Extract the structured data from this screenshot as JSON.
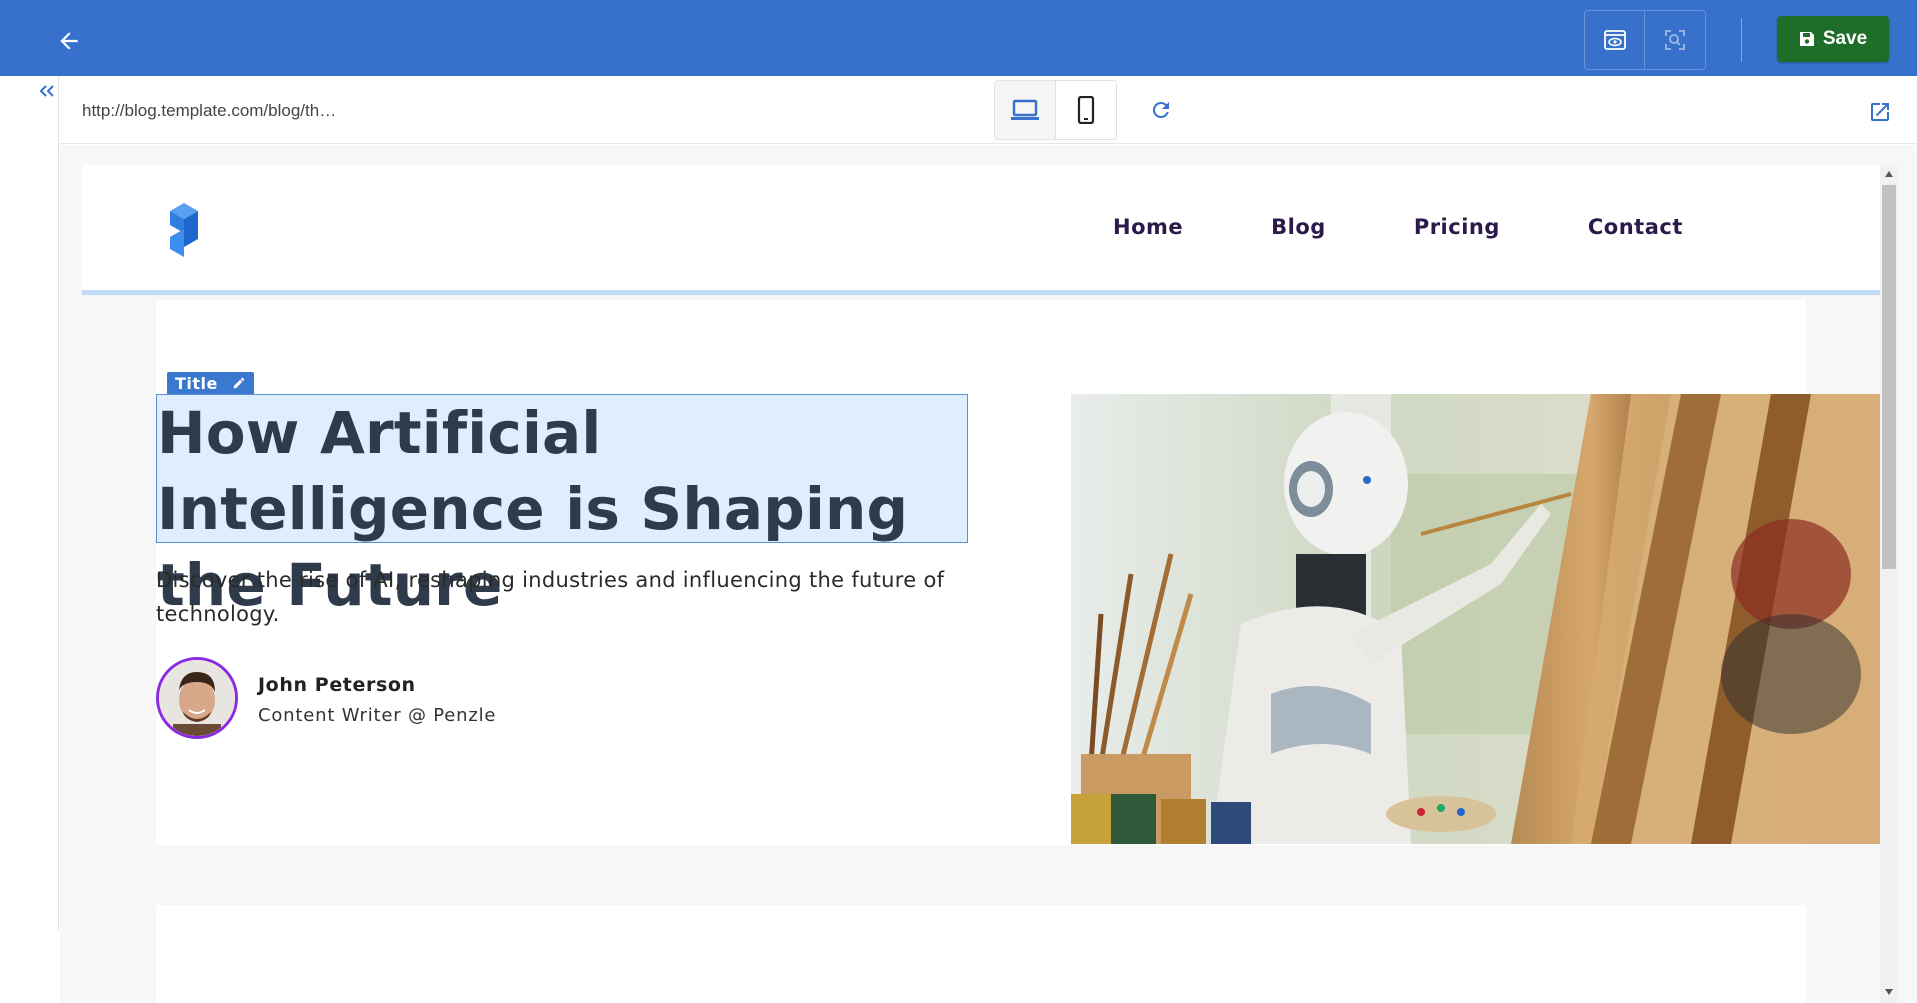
{
  "topbar": {
    "back_icon": "arrow-left-icon",
    "preview_icon": "eye-preview-icon",
    "inspect_icon": "zoom-search-icon",
    "save_label": "Save",
    "save_icon": "floppy-disk-icon",
    "bar_color": "#3871cc",
    "save_color": "#1e6e2a"
  },
  "leftpanel": {
    "collapse_icon": "double-chevron-left-icon"
  },
  "preview_toolbar": {
    "url": "http://blog.template.com/blog/th…",
    "desktop_icon": "laptop-icon",
    "mobile_icon": "smartphone-icon",
    "refresh_icon": "refresh-icon",
    "open_external_icon": "open-external-icon"
  },
  "site": {
    "logo_icon": "brand-logo-icon",
    "nav": [
      "Home",
      "Blog",
      "Pricing",
      "Contact"
    ],
    "nav_color": "#2b1a4a"
  },
  "hero": {
    "title_tag": "Title",
    "title_tag_icon": "pencil-icon",
    "title": "How Artificial Intelligence is Shaping the Future",
    "description": "Discover the rise of AI, reshaping industries and influencing the future of technology.",
    "author_name": "John Peterson",
    "author_role": "Content Writer @ Penzle",
    "avatar_ring_color": "#8a2be2",
    "image_subject": "robot-painting-canvas-image"
  }
}
